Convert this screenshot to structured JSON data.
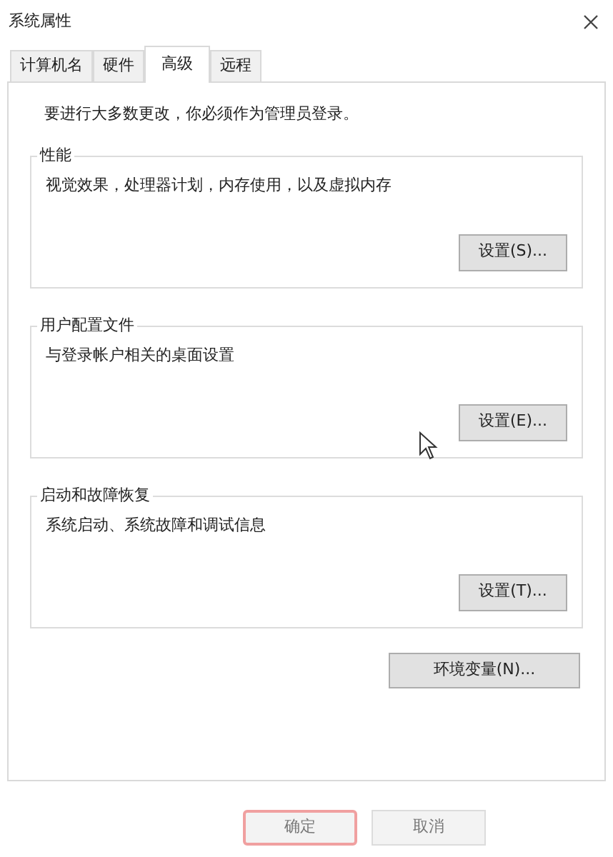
{
  "window": {
    "title": "系统属性"
  },
  "tabs": [
    {
      "label": "计算机名",
      "selected": false
    },
    {
      "label": "硬件",
      "selected": false
    },
    {
      "label": "高级",
      "selected": true
    },
    {
      "label": "远程",
      "selected": false
    }
  ],
  "notice": "要进行大多数更改，你必须作为管理员登录。",
  "groups": [
    {
      "title": "性能",
      "description": "视觉效果，处理器计划，内存使用，以及虚拟内存",
      "button": "设置(S)..."
    },
    {
      "title": "用户配置文件",
      "description": "与登录帐户相关的桌面设置",
      "button": "设置(E)..."
    },
    {
      "title": "启动和故障恢复",
      "description": "系统启动、系统故障和调试信息",
      "button": "设置(T)..."
    }
  ],
  "env_button": "环境变量(N)...",
  "footer_buttons": [
    {
      "label": "确定",
      "focused": true
    },
    {
      "label": "取消",
      "focused": false
    }
  ]
}
